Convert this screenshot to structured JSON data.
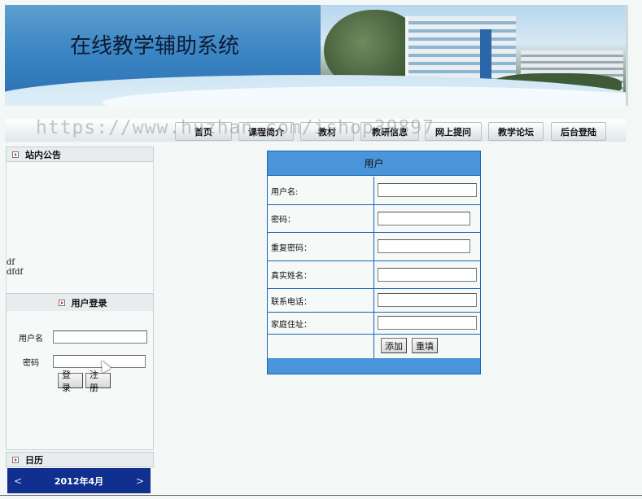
{
  "banner": {
    "title": "在线教学辅助系统"
  },
  "nav": {
    "watermark": "https://www.huzhan.com/ishop39897",
    "items": [
      "首页",
      "课程简介",
      "教材",
      "教研信息",
      "网上提问",
      "教学论坛",
      "后台登陆"
    ]
  },
  "notice": {
    "heading": "站内公告",
    "items": [
      "df",
      "dfdf"
    ]
  },
  "login": {
    "heading": "用户登录",
    "username_label": "用户名",
    "password_label": "密码",
    "login_button": "登录",
    "register_button": "注册"
  },
  "calendar": {
    "heading": "日历",
    "month": "2012年4月",
    "prev": "<",
    "next": ">"
  },
  "form": {
    "title": "用户",
    "fields": [
      "用户名:",
      "密码：",
      "重复密码：",
      "真实姓名：",
      "联系电话：",
      "家庭住址："
    ],
    "add_button": "添加",
    "reset_button": "重填"
  }
}
